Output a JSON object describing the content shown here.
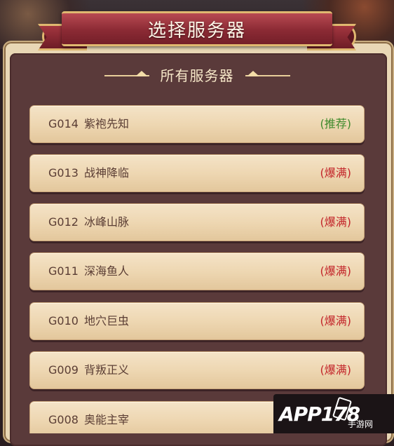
{
  "dialog": {
    "title": "选择服务器",
    "section_title": "所有服务器"
  },
  "servers": [
    {
      "code": "G014",
      "name": "紫袍先知",
      "status": "(推荐)",
      "status_type": "recommended"
    },
    {
      "code": "G013",
      "name": "战神降临",
      "status": "(爆满)",
      "status_type": "full"
    },
    {
      "code": "G012",
      "name": "冰峰山脉",
      "status": "(爆满)",
      "status_type": "full"
    },
    {
      "code": "G011",
      "name": "深海鱼人",
      "status": "(爆满)",
      "status_type": "full"
    },
    {
      "code": "G010",
      "name": "地穴巨虫",
      "status": "(爆满)",
      "status_type": "full"
    },
    {
      "code": "G009",
      "name": "背叛正义",
      "status": "(爆满)",
      "status_type": "full"
    },
    {
      "code": "G008",
      "name": "奥能主宰",
      "status": "",
      "status_type": "none"
    }
  ],
  "watermark": {
    "logo": "APP178",
    "sub": "手游网"
  },
  "colors": {
    "recommended": "#3f8a2c",
    "full": "#c3262b"
  }
}
